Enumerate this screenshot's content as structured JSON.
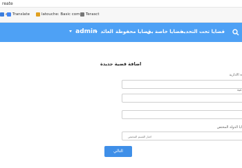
{
  "browser": {
    "url_fragment": "reate",
    "bookmarks": [
      {
        "label": "a",
        "color": "#3b7ddd"
      },
      {
        "label": "Translate",
        "color": "#4285f4"
      },
      {
        "label": "latouche: Basic com...",
        "color": "#e0a020"
      },
      {
        "label": "Terasct",
        "color": "#777777"
      }
    ]
  },
  "nav": {
    "search_icon": "search-icon",
    "items": [
      {
        "label": "قضايا تحت التحديد",
        "has_caret": false
      },
      {
        "label": "قضايا خاصة بي",
        "has_caret": false
      },
      {
        "label": "قضايا محفوظة",
        "has_caret": false
      },
      {
        "label": "العائد",
        "has_caret": true
      },
      {
        "label": "admin",
        "has_caret": true
      }
    ],
    "bg_color": "#4ea1f5"
  },
  "form": {
    "title": "اضافة قضية جديدة",
    "label_1": "ه الادارية",
    "label_2": "عية",
    "label_3": "ايا الدولة المختص",
    "select_placeholder": "اختار القسم المختص",
    "submit_label": "التالي"
  }
}
